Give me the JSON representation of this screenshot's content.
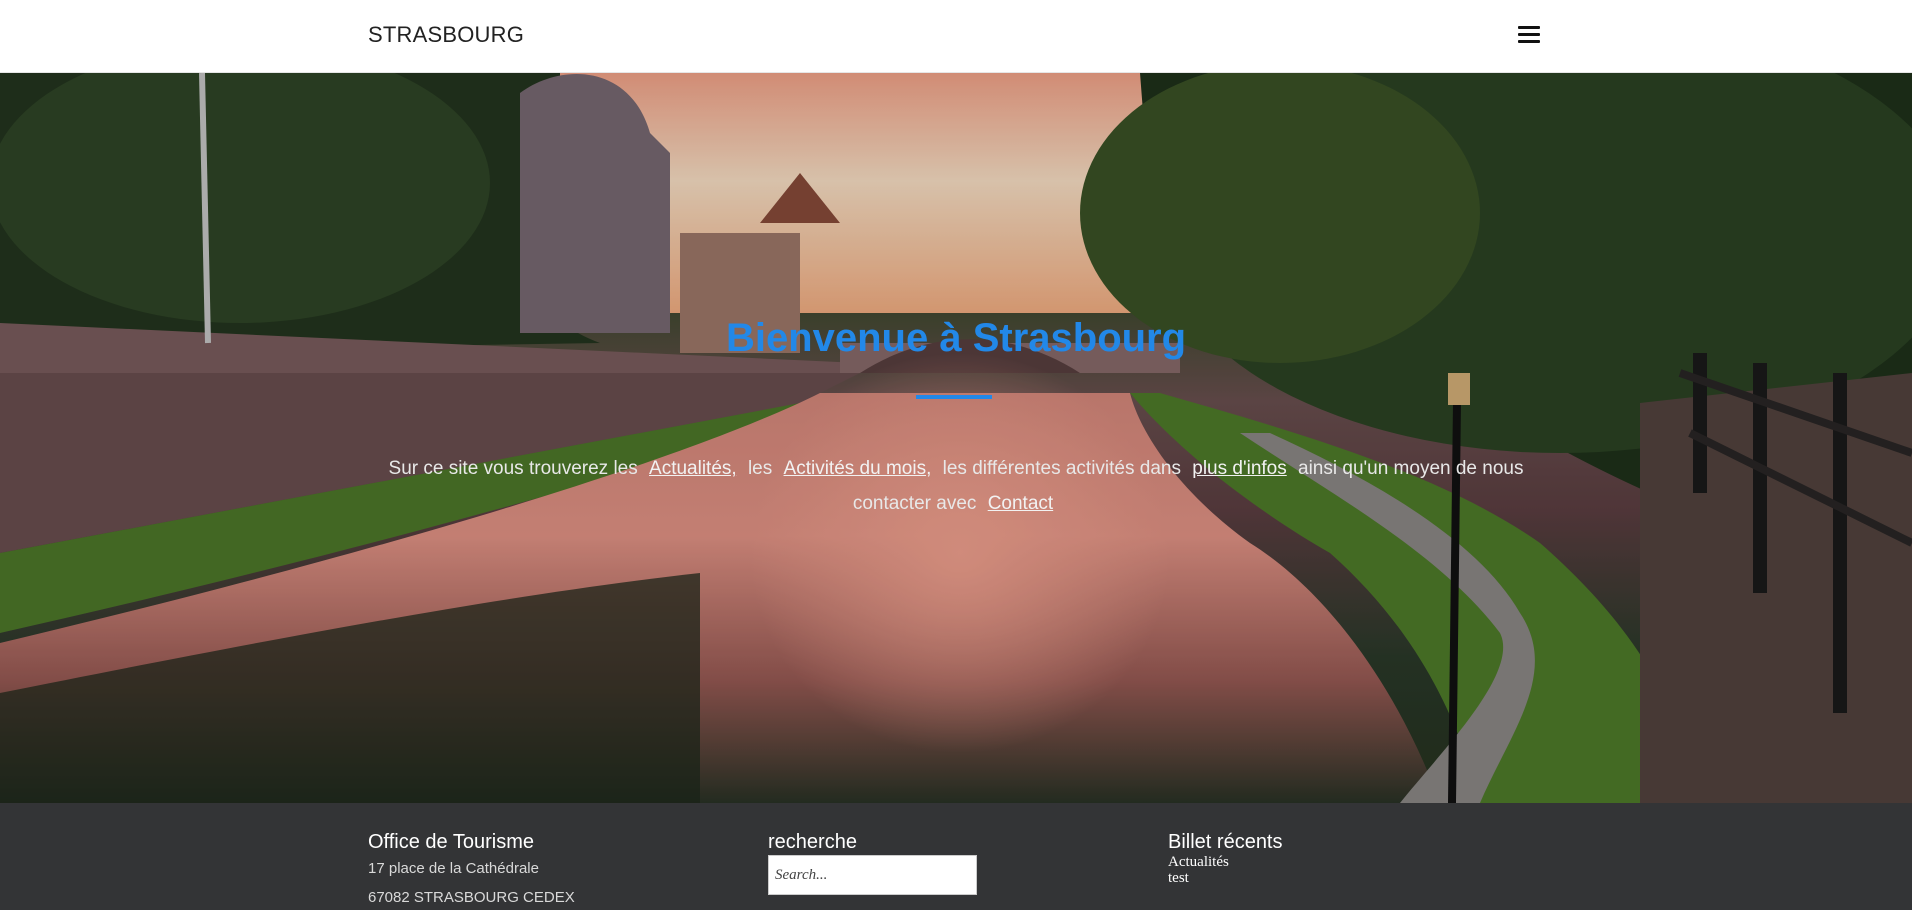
{
  "header": {
    "brand": "STRASBOURG",
    "menu_icon": "hamburger-menu-icon"
  },
  "hero": {
    "title": "Bienvenue à Strasbourg",
    "intro": {
      "t1": "Sur ce site vous trouverez les",
      "link_actualites": "Actualités,",
      "t2": "les",
      "link_activites": "Activités du mois,",
      "t3": "les différentes activités dans",
      "link_infos": "plus d'infos",
      "t4": "ainsi qu'un moyen de nous contacter avec",
      "link_contact": "Contact"
    },
    "colors": {
      "title": "#2288e8",
      "text": "#e8e8e8"
    }
  },
  "footer": {
    "office": {
      "title": "Office de Tourisme",
      "address_line1": "17 place de la Cathédrale",
      "address_line2": "67082 STRASBOURG CEDEX"
    },
    "search": {
      "title": "recherche",
      "placeholder": "Search..."
    },
    "recent": {
      "title": "Billet récents",
      "items": [
        "Actualités",
        "test"
      ]
    },
    "colors": {
      "background": "#333436"
    }
  }
}
